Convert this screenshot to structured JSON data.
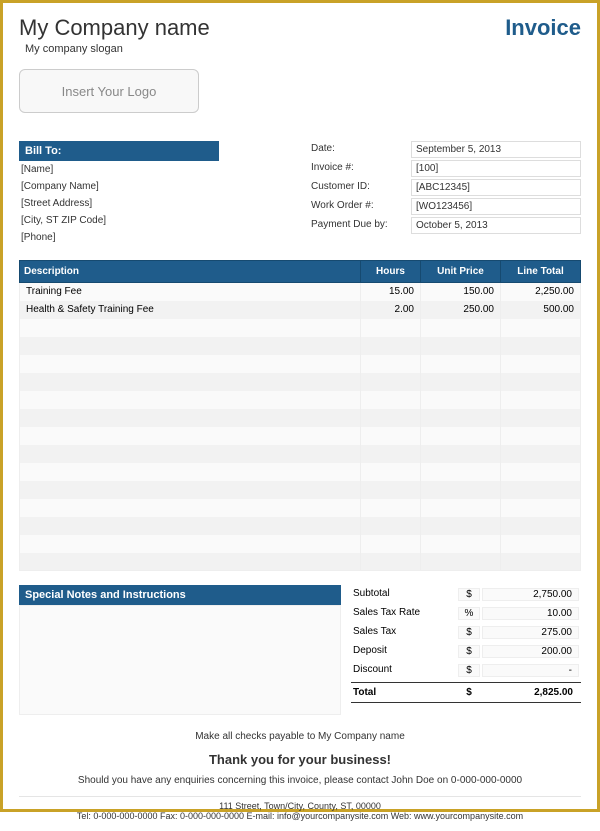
{
  "header": {
    "company_name": "My Company name",
    "slogan": "My company slogan",
    "invoice_title": "Invoice",
    "logo_placeholder": "Insert Your Logo"
  },
  "bill_to": {
    "header": "Bill To:",
    "lines": [
      "[Name]",
      "[Company Name]",
      "[Street Address]",
      "[City, ST  ZIP Code]",
      "[Phone]"
    ]
  },
  "meta": [
    {
      "label": "Date:",
      "value": "September 5, 2013"
    },
    {
      "label": "Invoice #:",
      "value": "[100]"
    },
    {
      "label": "Customer ID:",
      "value": "[ABC12345]"
    },
    {
      "label": "Work Order #:",
      "value": "[WO123456]"
    },
    {
      "label": "Payment Due by:",
      "value": "October 5, 2013"
    }
  ],
  "items": {
    "headers": [
      "Description",
      "Hours",
      "Unit Price",
      "Line Total"
    ],
    "rows": [
      {
        "desc": "Training Fee",
        "hours": "15.00",
        "price": "150.00",
        "total": "2,250.00"
      },
      {
        "desc": "Health & Safety Training Fee",
        "hours": "2.00",
        "price": "250.00",
        "total": "500.00"
      },
      {
        "desc": "",
        "hours": "",
        "price": "",
        "total": ""
      },
      {
        "desc": "",
        "hours": "",
        "price": "",
        "total": ""
      },
      {
        "desc": "",
        "hours": "",
        "price": "",
        "total": ""
      },
      {
        "desc": "",
        "hours": "",
        "price": "",
        "total": ""
      },
      {
        "desc": "",
        "hours": "",
        "price": "",
        "total": ""
      },
      {
        "desc": "",
        "hours": "",
        "price": "",
        "total": ""
      },
      {
        "desc": "",
        "hours": "",
        "price": "",
        "total": ""
      },
      {
        "desc": "",
        "hours": "",
        "price": "",
        "total": ""
      },
      {
        "desc": "",
        "hours": "",
        "price": "",
        "total": ""
      },
      {
        "desc": "",
        "hours": "",
        "price": "",
        "total": ""
      },
      {
        "desc": "",
        "hours": "",
        "price": "",
        "total": ""
      },
      {
        "desc": "",
        "hours": "",
        "price": "",
        "total": ""
      },
      {
        "desc": "",
        "hours": "",
        "price": "",
        "total": ""
      },
      {
        "desc": "",
        "hours": "",
        "price": "",
        "total": ""
      }
    ]
  },
  "notes_header": "Special Notes and Instructions",
  "totals": [
    {
      "label": "Subtotal",
      "sym": "$",
      "value": "2,750.00"
    },
    {
      "label": "Sales Tax Rate",
      "sym": "%",
      "value": "10.00"
    },
    {
      "label": "Sales Tax",
      "sym": "$",
      "value": "275.00"
    },
    {
      "label": "Deposit",
      "sym": "$",
      "value": "200.00"
    },
    {
      "label": "Discount",
      "sym": "$",
      "value": "-"
    }
  ],
  "grand_total": {
    "label": "Total",
    "sym": "$",
    "value": "2,825.00"
  },
  "footer": {
    "payable": "Make all checks payable to My Company name",
    "thanks": "Thank you for your business!",
    "enquiry": "Should you have any enquiries concerning this invoice, please contact John Doe on 0-000-000-0000",
    "address": "111 Street, Town/City, County, ST, 00000",
    "contact": "Tel: 0-000-000-0000 Fax: 0-000-000-0000 E-mail: info@yourcompanysite.com Web: www.yourcompanysite.com"
  }
}
